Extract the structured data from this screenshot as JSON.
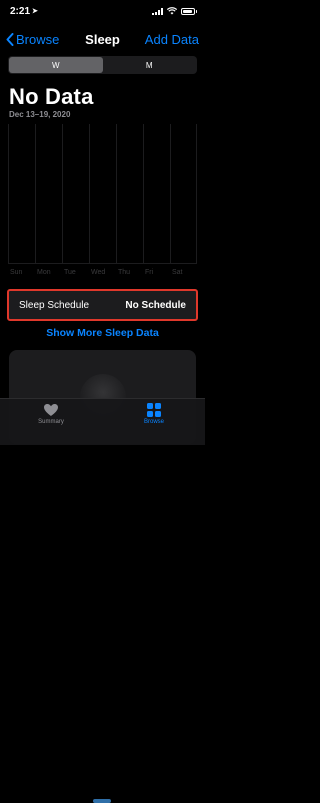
{
  "status_bar": {
    "time": "2:21"
  },
  "nav": {
    "back_label": "Browse",
    "title": "Sleep",
    "action_label": "Add Data"
  },
  "segments": [
    {
      "label": "W",
      "active": true
    },
    {
      "label": "M",
      "active": false
    }
  ],
  "summary": {
    "headline": "No Data",
    "date_range": "Dec 13–19, 2020"
  },
  "chart": {
    "days": [
      "Sun",
      "Mon",
      "Tue",
      "Wed",
      "Thu",
      "Fri",
      "Sat"
    ]
  },
  "sleep_schedule": {
    "label": "Sleep Schedule",
    "value": "No Schedule"
  },
  "show_more_label": "Show More Sleep Data",
  "tab_bar": {
    "items": [
      {
        "label": "Summary",
        "icon": "heart-icon",
        "active": false
      },
      {
        "label": "Browse",
        "icon": "grid-icon",
        "active": true
      }
    ]
  },
  "colors": {
    "accent": "#0a84ff",
    "highlight": "#e0382b"
  }
}
